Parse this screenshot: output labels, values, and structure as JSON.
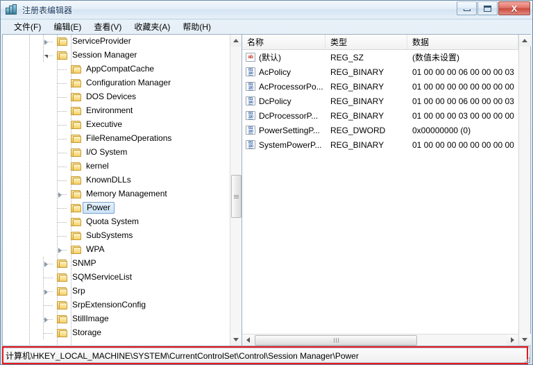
{
  "window": {
    "title": "注册表编辑器",
    "app_icon": "registry-editor-icon",
    "buttons": {
      "minimize": "最小化",
      "maximize": "最大化",
      "close": "X"
    }
  },
  "menu": [
    {
      "label": "文件(F)"
    },
    {
      "label": "编辑(E)"
    },
    {
      "label": "查看(V)"
    },
    {
      "label": "收藏夹(A)"
    },
    {
      "label": "帮助(H)"
    }
  ],
  "tree": {
    "items": [
      {
        "label": "ServiceProvider",
        "depth": 3,
        "expander": "closed",
        "selected": false
      },
      {
        "label": "Session Manager",
        "depth": 3,
        "expander": "open",
        "selected": false
      },
      {
        "label": "AppCompatCache",
        "depth": 4,
        "expander": "none",
        "selected": false
      },
      {
        "label": "Configuration Manager",
        "depth": 4,
        "expander": "none",
        "selected": false
      },
      {
        "label": "DOS Devices",
        "depth": 4,
        "expander": "none",
        "selected": false
      },
      {
        "label": "Environment",
        "depth": 4,
        "expander": "none",
        "selected": false
      },
      {
        "label": "Executive",
        "depth": 4,
        "expander": "none",
        "selected": false
      },
      {
        "label": "FileRenameOperations",
        "depth": 4,
        "expander": "none",
        "selected": false
      },
      {
        "label": "I/O System",
        "depth": 4,
        "expander": "none",
        "selected": false
      },
      {
        "label": "kernel",
        "depth": 4,
        "expander": "none",
        "selected": false
      },
      {
        "label": "KnownDLLs",
        "depth": 4,
        "expander": "none",
        "selected": false
      },
      {
        "label": "Memory Management",
        "depth": 4,
        "expander": "closed",
        "selected": false
      },
      {
        "label": "Power",
        "depth": 4,
        "expander": "none",
        "selected": true
      },
      {
        "label": "Quota System",
        "depth": 4,
        "expander": "none",
        "selected": false
      },
      {
        "label": "SubSystems",
        "depth": 4,
        "expander": "none",
        "selected": false
      },
      {
        "label": "WPA",
        "depth": 4,
        "expander": "closed",
        "selected": false
      },
      {
        "label": "SNMP",
        "depth": 3,
        "expander": "closed",
        "selected": false
      },
      {
        "label": "SQMServiceList",
        "depth": 3,
        "expander": "none",
        "selected": false
      },
      {
        "label": "Srp",
        "depth": 3,
        "expander": "closed",
        "selected": false
      },
      {
        "label": "SrpExtensionConfig",
        "depth": 3,
        "expander": "none",
        "selected": false
      },
      {
        "label": "StillImage",
        "depth": 3,
        "expander": "closed",
        "selected": false
      },
      {
        "label": "Storage",
        "depth": 3,
        "expander": "none",
        "selected": false
      }
    ]
  },
  "list": {
    "columns": [
      {
        "label": "名称"
      },
      {
        "label": "类型"
      },
      {
        "label": "数据"
      }
    ],
    "rows": [
      {
        "icon": "string-value-icon",
        "name": "(默认)",
        "type": "REG_SZ",
        "data": "(数值未设置)"
      },
      {
        "icon": "binary-value-icon",
        "name": "AcPolicy",
        "type": "REG_BINARY",
        "data": "01 00 00 00 06 00 00 00 03"
      },
      {
        "icon": "binary-value-icon",
        "name": "AcProcessorPo...",
        "type": "REG_BINARY",
        "data": "01 00 00 00 00 00 00 00 00"
      },
      {
        "icon": "binary-value-icon",
        "name": "DcPolicy",
        "type": "REG_BINARY",
        "data": "01 00 00 00 06 00 00 00 03"
      },
      {
        "icon": "binary-value-icon",
        "name": "DcProcessorP...",
        "type": "REG_BINARY",
        "data": "01 00 00 00 03 00 00 00 00"
      },
      {
        "icon": "binary-value-icon",
        "name": "PowerSettingP...",
        "type": "REG_DWORD",
        "data": "0x00000000 (0)"
      },
      {
        "icon": "binary-value-icon",
        "name": "SystemPowerP...",
        "type": "REG_BINARY",
        "data": "01 00 00 00 00 00 00 00 00"
      }
    ]
  },
  "statusbar": {
    "path": "计算机\\HKEY_LOCAL_MACHINE\\SYSTEM\\CurrentControlSet\\Control\\Session Manager\\Power"
  },
  "annotation": {
    "highlight_color": "#e8171a"
  }
}
